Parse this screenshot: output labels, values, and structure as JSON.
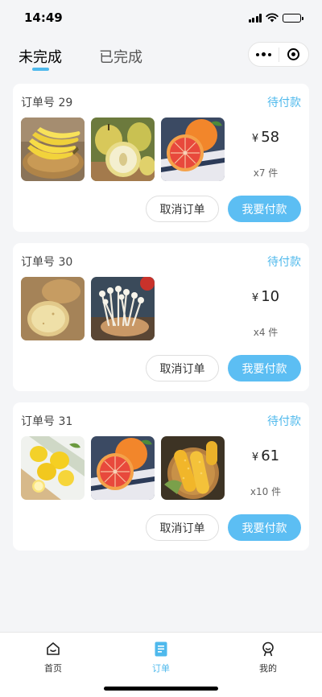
{
  "status_bar": {
    "time": "14:49"
  },
  "tabs": [
    {
      "label": "未完成",
      "active": true
    },
    {
      "label": "已完成",
      "active": false
    }
  ],
  "colors": {
    "accent": "#4fb9ec",
    "pay_button": "#5cbef3",
    "background": "#f4f5f7"
  },
  "orders": [
    {
      "order_no": "订单号 29",
      "status": "待付款",
      "products": [
        "banana",
        "pear",
        "grapefruit"
      ],
      "currency": "¥",
      "price": "58",
      "quantity": "x7 件",
      "cancel_label": "取消订单",
      "pay_label": "我要付款"
    },
    {
      "order_no": "订单号 30",
      "status": "待付款",
      "products": [
        "potato",
        "enoki-mushroom"
      ],
      "currency": "¥",
      "price": "10",
      "quantity": "x4 件",
      "cancel_label": "取消订单",
      "pay_label": "我要付款"
    },
    {
      "order_no": "订单号 31",
      "status": "待付款",
      "products": [
        "lemon",
        "grapefruit",
        "corn"
      ],
      "currency": "¥",
      "price": "61",
      "quantity": "x10 件",
      "cancel_label": "取消订单",
      "pay_label": "我要付款"
    }
  ],
  "bottom_nav": [
    {
      "label": "首页",
      "icon": "home-icon",
      "active": false
    },
    {
      "label": "订单",
      "icon": "order-doc-icon",
      "active": true
    },
    {
      "label": "我的",
      "icon": "profile-icon",
      "active": false
    }
  ]
}
